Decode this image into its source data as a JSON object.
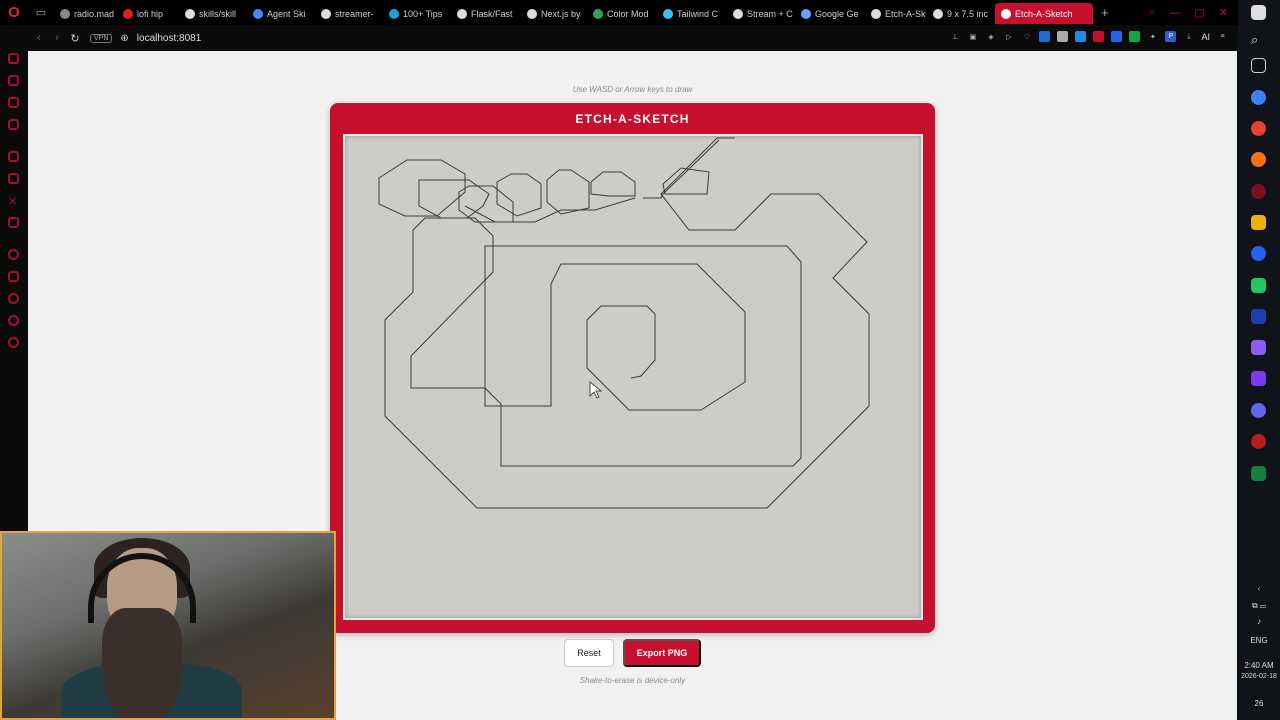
{
  "browser": {
    "tabs": [
      {
        "label": "radio.mad",
        "icon": "play-icon",
        "color": "#888888"
      },
      {
        "label": "lofi hip",
        "icon": "youtube-icon",
        "color": "#e02020"
      },
      {
        "label": "skills/skill",
        "icon": "github-icon",
        "color": "#dddddd"
      },
      {
        "label": "Agent Ski",
        "icon": "globe-icon",
        "color": "#3d8bff"
      },
      {
        "label": "streamer-",
        "icon": "github-icon",
        "color": "#dddddd"
      },
      {
        "label": "100+ Tips",
        "icon": "flag-icon",
        "color": "#1aa0d8"
      },
      {
        "label": "Flask/Fast",
        "icon": "g-icon",
        "color": "#dddddd"
      },
      {
        "label": "Next.js by",
        "icon": "n-icon",
        "color": "#dddddd"
      },
      {
        "label": "Color Mod",
        "icon": "colorwheel-icon",
        "color": "#2aa85a"
      },
      {
        "label": "Tailwind C",
        "icon": "tailwind-icon",
        "color": "#38bdf8"
      },
      {
        "label": "Stream + C",
        "icon": "page-icon",
        "color": "#dddddd"
      },
      {
        "label": "Google Ge",
        "icon": "gemini-icon",
        "color": "#6aa0ff"
      },
      {
        "label": "Etch-A-Sk",
        "icon": "brush-icon",
        "color": "#dddddd"
      },
      {
        "label": "9 x 7.5 inc",
        "icon": "google-icon",
        "color": "#dddddd"
      },
      {
        "label": "Etch-A-Sketch",
        "icon": "brush-icon",
        "color": "#ffffff",
        "active": true
      }
    ],
    "new_tab_label": "+",
    "vpn_label": "VPN",
    "url": "localhost:8081",
    "ai_label": "AI"
  },
  "page": {
    "hint_top": "Use WASD or Arrow keys to draw",
    "title": "ETCH-A-SKETCH",
    "reset_label": "Reset",
    "export_label": "Export PNG",
    "hint_bottom": "Shake-to-erase is device-only",
    "accent_color": "#c8102e",
    "screen_color": "#cdcdc8"
  },
  "taskbar": {
    "language": "ENG",
    "time": "2:40 AM",
    "date": "2026-02-18",
    "notification_count": "26"
  }
}
